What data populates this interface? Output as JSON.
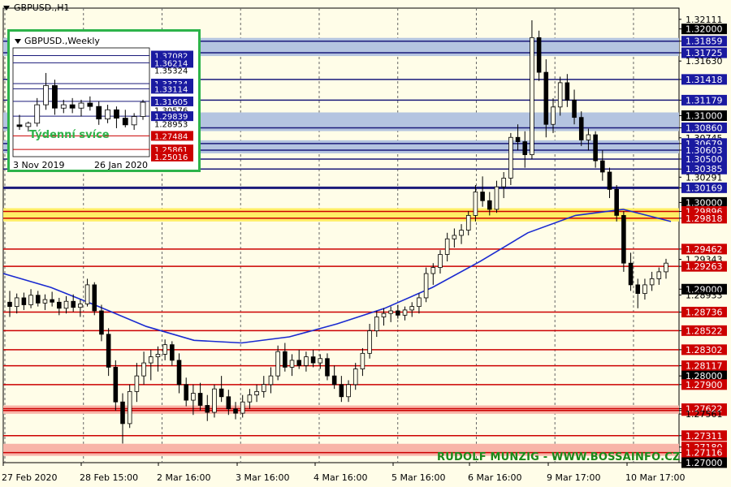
{
  "window": {
    "title": "GBPUSD.,H1"
  },
  "watermark": "RUDOLF MUNZIG - WWW.BOSSAINFO.CZ",
  "colors": {
    "background": "#fffde8",
    "level_red": "#cc0000",
    "level_navy": "#1a1a7a",
    "zone_blue": "#b4c4e0",
    "zone_yellow": "#ffee66",
    "zone_pink": "#f8b4a8",
    "ma": "#1a2ad0",
    "candle": "#000000",
    "label_red": "#cc0000",
    "label_blue": "#1a1aa0",
    "label_black": "#000000",
    "inset_border": "#2db34a"
  },
  "chart_data": {
    "type": "candlestick",
    "symbol": "GBPUSD.",
    "timeframe": "H1",
    "ylim": [
      1.27,
      1.3224
    ],
    "x_labels": [
      "27 Feb 2020",
      "28 Feb 15:00",
      "2 Mar 16:00",
      "3 Mar 16:00",
      "4 Mar 16:00",
      "5 Mar 16:00",
      "6 Mar 16:00",
      "9 Mar 17:00",
      "10 Mar 17:00"
    ],
    "price_labels": [
      {
        "value": "1.32111",
        "style": "plain"
      },
      {
        "value": "1.32000",
        "style": "black"
      },
      {
        "value": "1.31859",
        "style": "navy"
      },
      {
        "value": "1.31725",
        "style": "navy"
      },
      {
        "value": "1.31630",
        "style": "plain"
      },
      {
        "value": "1.31418",
        "style": "navy"
      },
      {
        "value": "1.31179",
        "style": "navy"
      },
      {
        "value": "1.31000",
        "style": "black"
      },
      {
        "value": "1.30860",
        "style": "navy"
      },
      {
        "value": "1.30745",
        "style": "plain"
      },
      {
        "value": "1.30679",
        "style": "navy"
      },
      {
        "value": "1.30603",
        "style": "navy"
      },
      {
        "value": "1.30500",
        "style": "navy"
      },
      {
        "value": "1.30385",
        "style": "navy"
      },
      {
        "value": "1.30291",
        "style": "plain"
      },
      {
        "value": "1.30169",
        "style": "navy"
      },
      {
        "value": "1.30000",
        "style": "black"
      },
      {
        "value": "1.29896",
        "style": "red"
      },
      {
        "value": "1.29818",
        "style": "red"
      },
      {
        "value": "1.29462",
        "style": "red"
      },
      {
        "value": "1.29343",
        "style": "plain"
      },
      {
        "value": "1.29263",
        "style": "red"
      },
      {
        "value": "1.29000",
        "style": "black"
      },
      {
        "value": "1.28933",
        "style": "plain"
      },
      {
        "value": "1.28736",
        "style": "red"
      },
      {
        "value": "1.28522",
        "style": "red"
      },
      {
        "value": "1.28302",
        "style": "red"
      },
      {
        "value": "1.28117",
        "style": "red"
      },
      {
        "value": "1.28000",
        "style": "black"
      },
      {
        "value": "1.27900",
        "style": "red"
      },
      {
        "value": "1.27601",
        "style": "red"
      },
      {
        "value": "1.27622",
        "style": "red"
      },
      {
        "value": "1.27561",
        "style": "plain"
      },
      {
        "value": "1.27311",
        "style": "red"
      },
      {
        "value": "1.27180",
        "style": "red"
      },
      {
        "value": "1.27116",
        "style": "red"
      },
      {
        "value": "1.27000",
        "style": "black"
      }
    ],
    "levels": [
      1.32,
      1.31859,
      1.31725,
      1.31418,
      1.31179,
      1.31,
      1.3086,
      1.30679,
      1.30603,
      1.305,
      1.30385,
      1.30169,
      1.3,
      1.29896,
      1.29818,
      1.29462,
      1.29263,
      1.29,
      1.28736,
      1.28522,
      1.28302,
      1.28117,
      1.28,
      1.279,
      1.27622,
      1.27601,
      1.27311,
      1.27116,
      1.27
    ],
    "zones": [
      {
        "from": 1.31725,
        "to": 1.31859,
        "color": "blue"
      },
      {
        "from": 1.3086,
        "to": 1.31,
        "color": "blue"
      },
      {
        "from": 1.30603,
        "to": 1.30679,
        "color": "blue"
      },
      {
        "from": 1.29818,
        "to": 1.29896,
        "color": "yellow"
      },
      {
        "from": 1.27601,
        "to": 1.27622,
        "color": "pink"
      },
      {
        "from": 1.27116,
        "to": 1.2718,
        "color": "pink"
      }
    ],
    "candles": [
      [
        1.2885,
        1.2898,
        1.2868,
        1.288
      ],
      [
        1.288,
        1.2895,
        1.2872,
        1.289
      ],
      [
        1.289,
        1.2896,
        1.2876,
        1.2882
      ],
      [
        1.2882,
        1.29,
        1.2878,
        1.2893
      ],
      [
        1.2893,
        1.2898,
        1.288,
        1.2884
      ],
      [
        1.2884,
        1.2894,
        1.2876,
        1.2888
      ],
      [
        1.2888,
        1.2897,
        1.288,
        1.2885
      ],
      [
        1.2885,
        1.289,
        1.287,
        1.2878
      ],
      [
        1.2878,
        1.2892,
        1.2872,
        1.2886
      ],
      [
        1.2886,
        1.2894,
        1.2874,
        1.2879
      ],
      [
        1.2879,
        1.2888,
        1.2868,
        1.2883
      ],
      [
        1.2883,
        1.2912,
        1.288,
        1.2905
      ],
      [
        1.2905,
        1.2908,
        1.287,
        1.2875
      ],
      [
        1.2875,
        1.2882,
        1.284,
        1.2848
      ],
      [
        1.2848,
        1.2855,
        1.28,
        1.281
      ],
      [
        1.281,
        1.2818,
        1.276,
        1.277
      ],
      [
        1.277,
        1.278,
        1.2722,
        1.2745
      ],
      [
        1.2745,
        1.279,
        1.274,
        1.2782
      ],
      [
        1.2782,
        1.2815,
        1.277,
        1.28
      ],
      [
        1.28,
        1.2828,
        1.279,
        1.2815
      ],
      [
        1.2815,
        1.283,
        1.2795,
        1.2822
      ],
      [
        1.2822,
        1.2834,
        1.2805,
        1.2825
      ],
      [
        1.2825,
        1.2842,
        1.2818,
        1.2836
      ],
      [
        1.2836,
        1.284,
        1.2812,
        1.2818
      ],
      [
        1.2818,
        1.2826,
        1.278,
        1.279
      ],
      [
        1.279,
        1.2798,
        1.2765,
        1.2772
      ],
      [
        1.2772,
        1.279,
        1.2755,
        1.278
      ],
      [
        1.278,
        1.2792,
        1.276,
        1.2766
      ],
      [
        1.2766,
        1.2778,
        1.2748,
        1.2758
      ],
      [
        1.2758,
        1.279,
        1.2752,
        1.2785
      ],
      [
        1.2785,
        1.28,
        1.277,
        1.2776
      ],
      [
        1.2776,
        1.2784,
        1.2755,
        1.2762
      ],
      [
        1.2762,
        1.277,
        1.275,
        1.2757
      ],
      [
        1.2757,
        1.2778,
        1.2752,
        1.277
      ],
      [
        1.277,
        1.2785,
        1.2762,
        1.2778
      ],
      [
        1.2778,
        1.279,
        1.277,
        1.2782
      ],
      [
        1.2782,
        1.28,
        1.2775,
        1.279
      ],
      [
        1.279,
        1.281,
        1.278,
        1.28
      ],
      [
        1.28,
        1.2835,
        1.2795,
        1.2828
      ],
      [
        1.2828,
        1.2838,
        1.2805,
        1.281
      ],
      [
        1.281,
        1.2825,
        1.28,
        1.2818
      ],
      [
        1.2818,
        1.283,
        1.2808,
        1.2812
      ],
      [
        1.2812,
        1.2828,
        1.2805,
        1.2822
      ],
      [
        1.2822,
        1.283,
        1.281,
        1.2815
      ],
      [
        1.2815,
        1.2825,
        1.2808,
        1.282
      ],
      [
        1.282,
        1.2826,
        1.2795,
        1.28
      ],
      [
        1.28,
        1.2812,
        1.2785,
        1.279
      ],
      [
        1.279,
        1.28,
        1.277,
        1.2776
      ],
      [
        1.2776,
        1.2795,
        1.277,
        1.279
      ],
      [
        1.279,
        1.2815,
        1.2784,
        1.2808
      ],
      [
        1.2808,
        1.2832,
        1.28,
        1.2826
      ],
      [
        1.2826,
        1.286,
        1.282,
        1.2852
      ],
      [
        1.2852,
        1.2875,
        1.2845,
        1.2868
      ],
      [
        1.2868,
        1.2878,
        1.2858,
        1.2872
      ],
      [
        1.2872,
        1.288,
        1.2862,
        1.2875
      ],
      [
        1.2875,
        1.2882,
        1.2866,
        1.287
      ],
      [
        1.287,
        1.288,
        1.2864,
        1.2876
      ],
      [
        1.2876,
        1.2885,
        1.2868,
        1.288
      ],
      [
        1.288,
        1.2895,
        1.2872,
        1.289
      ],
      [
        1.289,
        1.2925,
        1.2885,
        1.2918
      ],
      [
        1.2918,
        1.293,
        1.2905,
        1.2925
      ],
      [
        1.2925,
        1.2945,
        1.2918,
        1.294
      ],
      [
        1.294,
        1.2965,
        1.2932,
        1.2958
      ],
      [
        1.2958,
        1.297,
        1.2948,
        1.2962
      ],
      [
        1.2962,
        1.2975,
        1.2952,
        1.2968
      ],
      [
        1.2968,
        1.299,
        1.2962,
        1.2985
      ],
      [
        1.2985,
        1.302,
        1.2978,
        1.3012
      ],
      [
        1.3012,
        1.303,
        1.2995,
        1.3002
      ],
      [
        1.3002,
        1.3012,
        1.2985,
        1.2992
      ],
      [
        1.2992,
        1.3025,
        1.2988,
        1.3018
      ],
      [
        1.3018,
        1.3035,
        1.3005,
        1.3028
      ],
      [
        1.3028,
        1.308,
        1.302,
        1.3075
      ],
      [
        1.3075,
        1.309,
        1.306,
        1.307
      ],
      [
        1.307,
        1.3082,
        1.304,
        1.3055
      ],
      [
        1.3055,
        1.321,
        1.305,
        1.319
      ],
      [
        1.319,
        1.3198,
        1.314,
        1.315
      ],
      [
        1.315,
        1.3165,
        1.3075,
        1.309
      ],
      [
        1.309,
        1.312,
        1.308,
        1.311
      ],
      [
        1.311,
        1.3145,
        1.31,
        1.3138
      ],
      [
        1.3138,
        1.3148,
        1.311,
        1.3118
      ],
      [
        1.3118,
        1.313,
        1.309,
        1.3098
      ],
      [
        1.3098,
        1.3105,
        1.3065,
        1.3072
      ],
      [
        1.3072,
        1.3085,
        1.306,
        1.3078
      ],
      [
        1.3078,
        1.3082,
        1.304,
        1.3048
      ],
      [
        1.3048,
        1.306,
        1.3025,
        1.3035
      ],
      [
        1.3035,
        1.304,
        1.3005,
        1.3015
      ],
      [
        1.3015,
        1.302,
        1.2978,
        1.2985
      ],
      [
        1.2985,
        1.299,
        1.292,
        1.293
      ],
      [
        1.293,
        1.2942,
        1.2898,
        1.2905
      ],
      [
        1.2905,
        1.2912,
        1.2878,
        1.2895
      ],
      [
        1.2895,
        1.2912,
        1.2888,
        1.2905
      ],
      [
        1.2905,
        1.292,
        1.2898,
        1.2912
      ],
      [
        1.2912,
        1.2925,
        1.2905,
        1.292
      ],
      [
        1.292,
        1.2935,
        1.2912,
        1.293
      ]
    ],
    "ma": [
      1.2918,
      1.2902,
      1.288,
      1.2857,
      1.2841,
      1.2838,
      1.2845,
      1.286,
      1.2878,
      1.2902,
      1.2932,
      1.2965,
      1.2985,
      1.2992,
      1.2978
    ],
    "inset": {
      "title": "GBPUSD.,Weekly",
      "label": "Týdenní svíce",
      "x_labels": [
        "3 Nov 2019",
        "26 Jan 2020"
      ],
      "price_labels": [
        {
          "value": "1.37082",
          "style": "blue"
        },
        {
          "value": "1.36214",
          "style": "blue"
        },
        {
          "value": "1.35324",
          "style": "plain"
        },
        {
          "value": "1.33734",
          "style": "blue"
        },
        {
          "value": "1.33114",
          "style": "blue"
        },
        {
          "value": "1.31605",
          "style": "blue"
        },
        {
          "value": "1.30576",
          "style": "plain"
        },
        {
          "value": "1.29839",
          "style": "blue"
        },
        {
          "value": "1.28953",
          "style": "plain"
        },
        {
          "value": "1.27484",
          "style": "red"
        },
        {
          "value": "1.25861",
          "style": "red"
        },
        {
          "value": "1.25016",
          "style": "red"
        }
      ],
      "candles": [
        [
          1.288,
          1.3,
          1.282,
          1.286
        ],
        [
          1.286,
          1.292,
          1.28,
          1.29
        ],
        [
          1.29,
          1.32,
          1.286,
          1.312
        ],
        [
          1.312,
          1.35,
          1.306,
          1.335
        ],
        [
          1.335,
          1.342,
          1.3,
          1.308
        ],
        [
          1.308,
          1.318,
          1.302,
          1.312
        ],
        [
          1.312,
          1.32,
          1.302,
          1.308
        ],
        [
          1.308,
          1.318,
          1.298,
          1.314
        ],
        [
          1.314,
          1.322,
          1.305,
          1.31
        ],
        [
          1.31,
          1.316,
          1.288,
          1.295
        ],
        [
          1.295,
          1.312,
          1.29,
          1.306
        ],
        [
          1.306,
          1.31,
          1.284,
          1.296
        ],
        [
          1.296,
          1.306,
          1.285,
          1.288
        ],
        [
          1.288,
          1.302,
          1.282,
          1.298
        ],
        [
          1.298,
          1.318,
          1.294,
          1.315
        ]
      ],
      "ylim": [
        1.25,
        1.38
      ]
    }
  }
}
